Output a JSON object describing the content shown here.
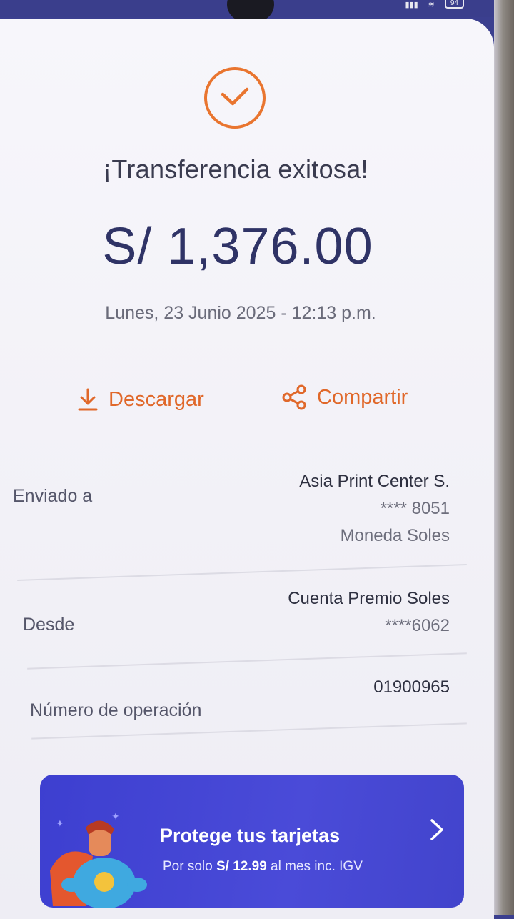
{
  "status_bar": {
    "battery": "94"
  },
  "receipt": {
    "title": "¡Transferencia exitosa!",
    "amount": "S/ 1,376.00",
    "datetime": "Lunes, 23 Junio 2025 - 12:13 p.m.",
    "actions": {
      "download": "Descargar",
      "share": "Compartir"
    },
    "sent_to": {
      "label": "Enviado a",
      "name": "Asia Print Center S.",
      "account": "**** 8051",
      "currency": "Moneda Soles"
    },
    "from": {
      "label": "Desde",
      "account_name": "Cuenta Premio Soles",
      "account": "****6062"
    },
    "operation": {
      "label": "Número de operación",
      "number": "01900965"
    }
  },
  "promo": {
    "title": "Protege tus tarjetas",
    "subtitle_prefix": "Por solo",
    "price": "S/ 12.99",
    "subtitle_suffix": "al mes inc. IGV"
  },
  "colors": {
    "accent": "#e9752f",
    "brand": "#3d3fd0",
    "amount_text": "#2f3366"
  },
  "icons": [
    "check-icon",
    "download-icon",
    "share-icon",
    "chevron-right-icon",
    "superhero-icon"
  ]
}
